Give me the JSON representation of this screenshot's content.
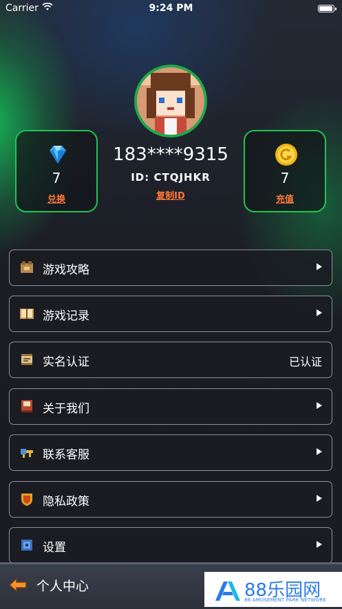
{
  "status_bar": {
    "carrier": "Carrier",
    "time": "9:24 PM",
    "battery_level": 1.0
  },
  "profile": {
    "phone": "183****9315",
    "id_label": "ID: CTQJHKR",
    "copy_id": "复制ID"
  },
  "gems": {
    "value": "7",
    "action": "兑换",
    "icon": "gem-icon"
  },
  "coins": {
    "value": "7",
    "action": "充值",
    "icon": "coin-icon"
  },
  "menu": [
    {
      "label": "游戏攻略",
      "icon": "guide-icon",
      "trailing": "arrow"
    },
    {
      "label": "游戏记录",
      "icon": "book-icon",
      "trailing": "arrow"
    },
    {
      "label": "实名认证",
      "icon": "scroll-icon",
      "trailing": "text",
      "status": "已认证"
    },
    {
      "label": "关于我们",
      "icon": "info-book-icon",
      "trailing": "arrow"
    },
    {
      "label": "联系客服",
      "icon": "service-icon",
      "trailing": "arrow"
    },
    {
      "label": "隐私政策",
      "icon": "shield-icon",
      "trailing": "arrow"
    },
    {
      "label": "设置",
      "icon": "settings-icon",
      "trailing": "arrow"
    }
  ],
  "bottom_bar": {
    "title": "个人中心"
  },
  "watermark": {
    "brand": "88乐园网",
    "tagline": "88 AMUSEMENT PARK NETWORK"
  }
}
